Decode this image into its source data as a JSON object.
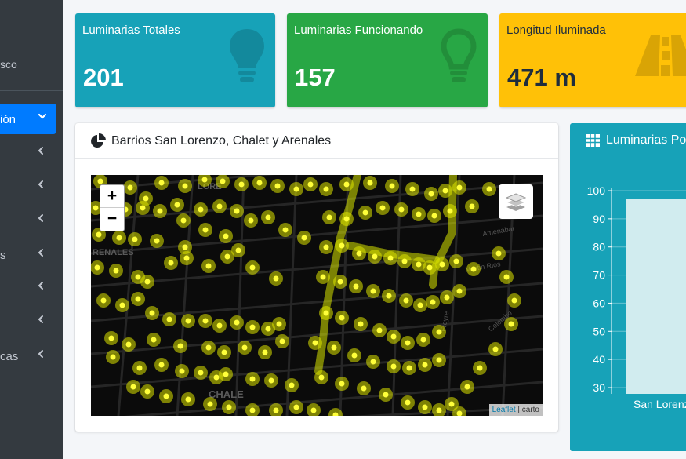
{
  "sidebar": {
    "user_name": "sco",
    "active_item": {
      "label": "ión",
      "chevron": "chevron-down-icon"
    },
    "items": [
      {
        "label": "",
        "chevron": "chevron-left-icon"
      },
      {
        "label": "",
        "chevron": "chevron-left-icon"
      },
      {
        "label": "",
        "chevron": "chevron-left-icon"
      },
      {
        "label": "s",
        "chevron": "chevron-left-icon"
      },
      {
        "label": "",
        "chevron": "chevron-left-icon"
      },
      {
        "label": "",
        "chevron": "chevron-left-icon"
      },
      {
        "label": "cas",
        "chevron": "chevron-left-icon"
      }
    ]
  },
  "info_boxes": [
    {
      "title": "Luminarias Totales",
      "value": "201",
      "icon": "lightbulb-icon",
      "color": "#17a2b8"
    },
    {
      "title": "Luminarias Funcionando",
      "value": "157",
      "icon": "lightbulb-outline-icon",
      "color": "#28a745"
    },
    {
      "title": "Longitud Iluminada",
      "value": "471 m",
      "icon": "road-icon",
      "color": "#ffc107"
    }
  ],
  "map_card": {
    "title": "Barrios San Lorenzo, Chalet y Arenales",
    "zoom_in": "+",
    "zoom_out": "−",
    "attribution_link": "Leaflet",
    "attribution_sep": " | ",
    "attribution_text": "carto",
    "map_labels": [
      "LORE",
      "RENALES",
      "CHALE",
      "Amenabar",
      "Martin Rios",
      "Colombo",
      "Freyre"
    ]
  },
  "chart_card": {
    "title": "Luminarias Po",
    "chart_data": {
      "type": "bar",
      "categories": [
        "San Lorenzo"
      ],
      "series": [
        {
          "values": [
            97
          ]
        }
      ],
      "y_ticks": [
        "100",
        "90",
        "80",
        "70",
        "60",
        "50",
        "40",
        "30"
      ],
      "ylim": [
        30,
        100
      ],
      "grid": true,
      "bar_color": "#d1ecef"
    }
  }
}
